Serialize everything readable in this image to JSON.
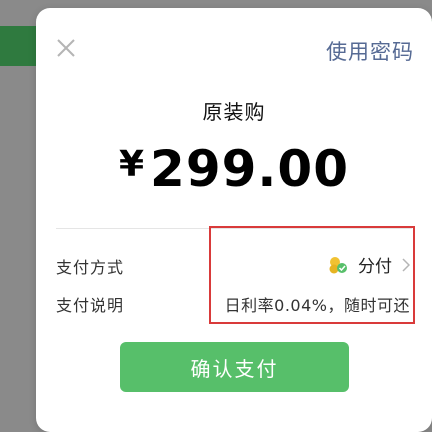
{
  "header": {
    "close_icon": "close-icon",
    "use_password_label": "使用密码"
  },
  "order": {
    "title": "原装购",
    "currency_symbol": "¥",
    "amount": "299.00"
  },
  "rows": {
    "payment_method_label": "支付方式",
    "payment_method_value": "分付",
    "payment_method_icon": "fenfu-logo-icon",
    "payment_note_label": "支付说明",
    "payment_note_value": "日利率0.04%，随时可还"
  },
  "actions": {
    "confirm_label": "确认支付"
  },
  "colors": {
    "accent_green": "#57bf6a",
    "link_blue": "#566a94",
    "highlight_red": "#d93a3a",
    "overlay_gray": "#8a8a8a"
  }
}
